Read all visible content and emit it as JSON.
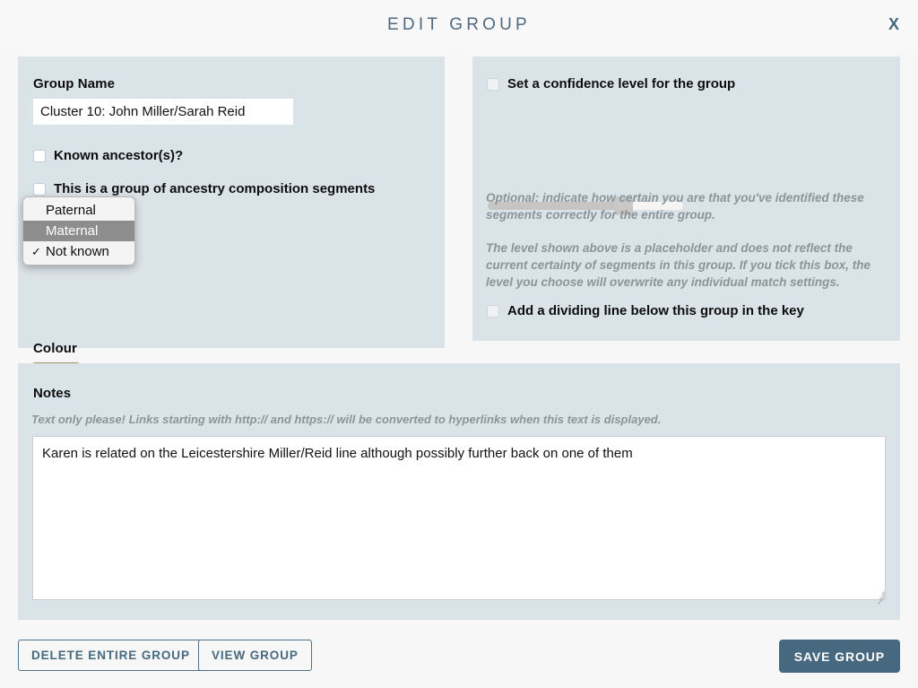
{
  "header": {
    "title": "EDIT GROUP",
    "close_label": "X"
  },
  "left_panel": {
    "group_name_label": "Group Name",
    "group_name_value": "Cluster 10: John Miller/Sarah Reid",
    "group_name_placeholder": "Group Name",
    "known_ancestors_label": "Known ancestor(s)?",
    "ancestry_composition_label": "This is a group of ancestry composition segments",
    "dropdown": {
      "open": true,
      "selected": "Not known",
      "highlighted": "Maternal",
      "check_glyph": "✓",
      "options": [
        {
          "label": "Paternal",
          "checked": false,
          "highlighted": false
        },
        {
          "label": "Maternal",
          "checked": false,
          "highlighted": true
        },
        {
          "label": "Not known",
          "checked": true,
          "highlighted": false
        }
      ]
    },
    "colour_label": "Colour",
    "colour_value": "#b7c9ee",
    "colour_caret": "▾"
  },
  "right_panel": {
    "confidence_label": "Set a confidence level for the group",
    "slider_value": "68",
    "help_text_1": "Optional: indicate how certain you are that you've identified these segments correctly for the entire group.",
    "help_text_2": "The level shown above is a placeholder and does not reflect the current certainty of segments in this group. If you tick this box, the level you choose will overwrite any individual match settings.",
    "divider_line_label": "Add a dividing line below this group in the key"
  },
  "notes_panel": {
    "label": "Notes",
    "help_text": "Text only please! Links starting with http:// and https:// will be converted to hyperlinks when this text is displayed.",
    "value": "Karen is related on the Leicestershire Miller/Reid line although possibly further back on one of them",
    "placeholder": "Notes"
  },
  "footer": {
    "delete_label": "DELETE ENTIRE GROUP",
    "view_label": "VIEW GROUP",
    "save_label": "SAVE GROUP"
  },
  "colors": {
    "panel_bg": "#dae3e8",
    "page_bg": "#f7f7f7",
    "accent": "#46697f",
    "help_text": "#8b949b",
    "dropdown_highlight": "#8d8d8d"
  }
}
